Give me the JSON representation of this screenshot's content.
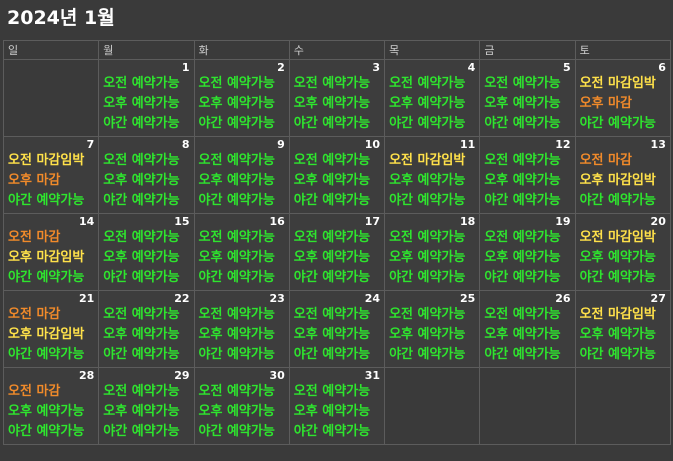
{
  "calendar": {
    "title": "2024년 1월",
    "weekdays": [
      "일",
      "월",
      "화",
      "수",
      "목",
      "금",
      "토"
    ],
    "status_colors": {
      "available": "#2ee52e",
      "nearly_full": "#ffe14a",
      "closed": "#f08a2a"
    },
    "weeks": [
      [
        null,
        {
          "day": "1",
          "slots": [
            {
              "text": "오전 예약가능",
              "status": "available"
            },
            {
              "text": "오후 예약가능",
              "status": "available"
            },
            {
              "text": "야간 예약가능",
              "status": "available"
            }
          ]
        },
        {
          "day": "2",
          "slots": [
            {
              "text": "오전 예약가능",
              "status": "available"
            },
            {
              "text": "오후 예약가능",
              "status": "available"
            },
            {
              "text": "야간 예약가능",
              "status": "available"
            }
          ]
        },
        {
          "day": "3",
          "slots": [
            {
              "text": "오전 예약가능",
              "status": "available"
            },
            {
              "text": "오후 예약가능",
              "status": "available"
            },
            {
              "text": "야간 예약가능",
              "status": "available"
            }
          ]
        },
        {
          "day": "4",
          "slots": [
            {
              "text": "오전 예약가능",
              "status": "available"
            },
            {
              "text": "오후 예약가능",
              "status": "available"
            },
            {
              "text": "야간 예약가능",
              "status": "available"
            }
          ]
        },
        {
          "day": "5",
          "slots": [
            {
              "text": "오전 예약가능",
              "status": "available"
            },
            {
              "text": "오후 예약가능",
              "status": "available"
            },
            {
              "text": "야간 예약가능",
              "status": "available"
            }
          ]
        },
        {
          "day": "6",
          "slots": [
            {
              "text": "오전 마감임박",
              "status": "nearly_full"
            },
            {
              "text": "오후 마감",
              "status": "closed"
            },
            {
              "text": "야간 예약가능",
              "status": "available"
            }
          ]
        }
      ],
      [
        {
          "day": "7",
          "slots": [
            {
              "text": "오전 마감임박",
              "status": "nearly_full"
            },
            {
              "text": "오후 마감",
              "status": "closed"
            },
            {
              "text": "야간 예약가능",
              "status": "available"
            }
          ]
        },
        {
          "day": "8",
          "slots": [
            {
              "text": "오전 예약가능",
              "status": "available"
            },
            {
              "text": "오후 예약가능",
              "status": "available"
            },
            {
              "text": "야간 예약가능",
              "status": "available"
            }
          ]
        },
        {
          "day": "9",
          "slots": [
            {
              "text": "오전 예약가능",
              "status": "available"
            },
            {
              "text": "오후 예약가능",
              "status": "available"
            },
            {
              "text": "야간 예약가능",
              "status": "available"
            }
          ]
        },
        {
          "day": "10",
          "slots": [
            {
              "text": "오전 예약가능",
              "status": "available"
            },
            {
              "text": "오후 예약가능",
              "status": "available"
            },
            {
              "text": "야간 예약가능",
              "status": "available"
            }
          ]
        },
        {
          "day": "11",
          "slots": [
            {
              "text": "오전 마감임박",
              "status": "nearly_full"
            },
            {
              "text": "오후 예약가능",
              "status": "available"
            },
            {
              "text": "야간 예약가능",
              "status": "available"
            }
          ]
        },
        {
          "day": "12",
          "slots": [
            {
              "text": "오전 예약가능",
              "status": "available"
            },
            {
              "text": "오후 예약가능",
              "status": "available"
            },
            {
              "text": "야간 예약가능",
              "status": "available"
            }
          ]
        },
        {
          "day": "13",
          "slots": [
            {
              "text": "오전 마감",
              "status": "closed"
            },
            {
              "text": "오후 마감임박",
              "status": "nearly_full"
            },
            {
              "text": "야간 예약가능",
              "status": "available"
            }
          ]
        }
      ],
      [
        {
          "day": "14",
          "slots": [
            {
              "text": "오전 마감",
              "status": "closed"
            },
            {
              "text": "오후 마감임박",
              "status": "nearly_full"
            },
            {
              "text": "야간 예약가능",
              "status": "available"
            }
          ]
        },
        {
          "day": "15",
          "slots": [
            {
              "text": "오전 예약가능",
              "status": "available"
            },
            {
              "text": "오후 예약가능",
              "status": "available"
            },
            {
              "text": "야간 예약가능",
              "status": "available"
            }
          ]
        },
        {
          "day": "16",
          "slots": [
            {
              "text": "오전 예약가능",
              "status": "available"
            },
            {
              "text": "오후 예약가능",
              "status": "available"
            },
            {
              "text": "야간 예약가능",
              "status": "available"
            }
          ]
        },
        {
          "day": "17",
          "slots": [
            {
              "text": "오전 예약가능",
              "status": "available"
            },
            {
              "text": "오후 예약가능",
              "status": "available"
            },
            {
              "text": "야간 예약가능",
              "status": "available"
            }
          ]
        },
        {
          "day": "18",
          "slots": [
            {
              "text": "오전 예약가능",
              "status": "available"
            },
            {
              "text": "오후 예약가능",
              "status": "available"
            },
            {
              "text": "야간 예약가능",
              "status": "available"
            }
          ]
        },
        {
          "day": "19",
          "slots": [
            {
              "text": "오전 예약가능",
              "status": "available"
            },
            {
              "text": "오후 예약가능",
              "status": "available"
            },
            {
              "text": "야간 예약가능",
              "status": "available"
            }
          ]
        },
        {
          "day": "20",
          "slots": [
            {
              "text": "오전 마감임박",
              "status": "nearly_full"
            },
            {
              "text": "오후 예약가능",
              "status": "available"
            },
            {
              "text": "야간 예약가능",
              "status": "available"
            }
          ]
        }
      ],
      [
        {
          "day": "21",
          "slots": [
            {
              "text": "오전 마감",
              "status": "closed"
            },
            {
              "text": "오후 마감임박",
              "status": "nearly_full"
            },
            {
              "text": "야간 예약가능",
              "status": "available"
            }
          ]
        },
        {
          "day": "22",
          "slots": [
            {
              "text": "오전 예약가능",
              "status": "available"
            },
            {
              "text": "오후 예약가능",
              "status": "available"
            },
            {
              "text": "야간 예약가능",
              "status": "available"
            }
          ]
        },
        {
          "day": "23",
          "slots": [
            {
              "text": "오전 예약가능",
              "status": "available"
            },
            {
              "text": "오후 예약가능",
              "status": "available"
            },
            {
              "text": "야간 예약가능",
              "status": "available"
            }
          ]
        },
        {
          "day": "24",
          "slots": [
            {
              "text": "오전 예약가능",
              "status": "available"
            },
            {
              "text": "오후 예약가능",
              "status": "available"
            },
            {
              "text": "야간 예약가능",
              "status": "available"
            }
          ]
        },
        {
          "day": "25",
          "slots": [
            {
              "text": "오전 예약가능",
              "status": "available"
            },
            {
              "text": "오후 예약가능",
              "status": "available"
            },
            {
              "text": "야간 예약가능",
              "status": "available"
            }
          ]
        },
        {
          "day": "26",
          "slots": [
            {
              "text": "오전 예약가능",
              "status": "available"
            },
            {
              "text": "오후 예약가능",
              "status": "available"
            },
            {
              "text": "야간 예약가능",
              "status": "available"
            }
          ]
        },
        {
          "day": "27",
          "slots": [
            {
              "text": "오전 마감임박",
              "status": "nearly_full"
            },
            {
              "text": "오후 예약가능",
              "status": "available"
            },
            {
              "text": "야간 예약가능",
              "status": "available"
            }
          ]
        }
      ],
      [
        {
          "day": "28",
          "slots": [
            {
              "text": "오전 마감",
              "status": "closed"
            },
            {
              "text": "오후 예약가능",
              "status": "available"
            },
            {
              "text": "야간 예약가능",
              "status": "available"
            }
          ]
        },
        {
          "day": "29",
          "slots": [
            {
              "text": "오전 예약가능",
              "status": "available"
            },
            {
              "text": "오후 예약가능",
              "status": "available"
            },
            {
              "text": "야간 예약가능",
              "status": "available"
            }
          ]
        },
        {
          "day": "30",
          "slots": [
            {
              "text": "오전 예약가능",
              "status": "available"
            },
            {
              "text": "오후 예약가능",
              "status": "available"
            },
            {
              "text": "야간 예약가능",
              "status": "available"
            }
          ]
        },
        {
          "day": "31",
          "slots": [
            {
              "text": "오전 예약가능",
              "status": "available"
            },
            {
              "text": "오후 예약가능",
              "status": "available"
            },
            {
              "text": "야간 예약가능",
              "status": "available"
            }
          ]
        },
        null,
        null,
        null
      ]
    ]
  }
}
